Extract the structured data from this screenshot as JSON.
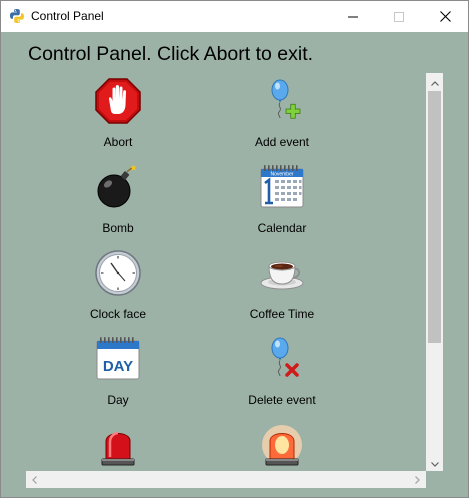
{
  "window": {
    "title": "Control Panel",
    "minimize_icon": "minimize-icon",
    "maximize_icon": "maximize-icon",
    "close_icon": "close-icon"
  },
  "heading": "Control Panel. Click Abort to exit.",
  "items": [
    {
      "label": "Abort",
      "icon": "stop-hand-icon"
    },
    {
      "label": "Add event",
      "icon": "balloon-plus-icon"
    },
    {
      "label": "Bomb",
      "icon": "bomb-icon"
    },
    {
      "label": "Calendar",
      "icon": "calendar-icon"
    },
    {
      "label": "Clock face",
      "icon": "clock-icon"
    },
    {
      "label": "Coffee Time",
      "icon": "coffee-cup-icon"
    },
    {
      "label": "Day",
      "icon": "day-calendar-icon"
    },
    {
      "label": "Delete event",
      "icon": "balloon-delete-icon"
    },
    {
      "label": "",
      "icon": "red-siren-icon"
    },
    {
      "label": "",
      "icon": "glowing-siren-icon"
    }
  ],
  "icon_texts": {
    "calendar_month": "November",
    "day_word": "DAY"
  },
  "colors": {
    "window_background": "#9db2a7",
    "titlebar": "#ffffff",
    "scrollbar_track": "#f0f0f0",
    "scrollbar_thumb": "#c1c1c1"
  }
}
